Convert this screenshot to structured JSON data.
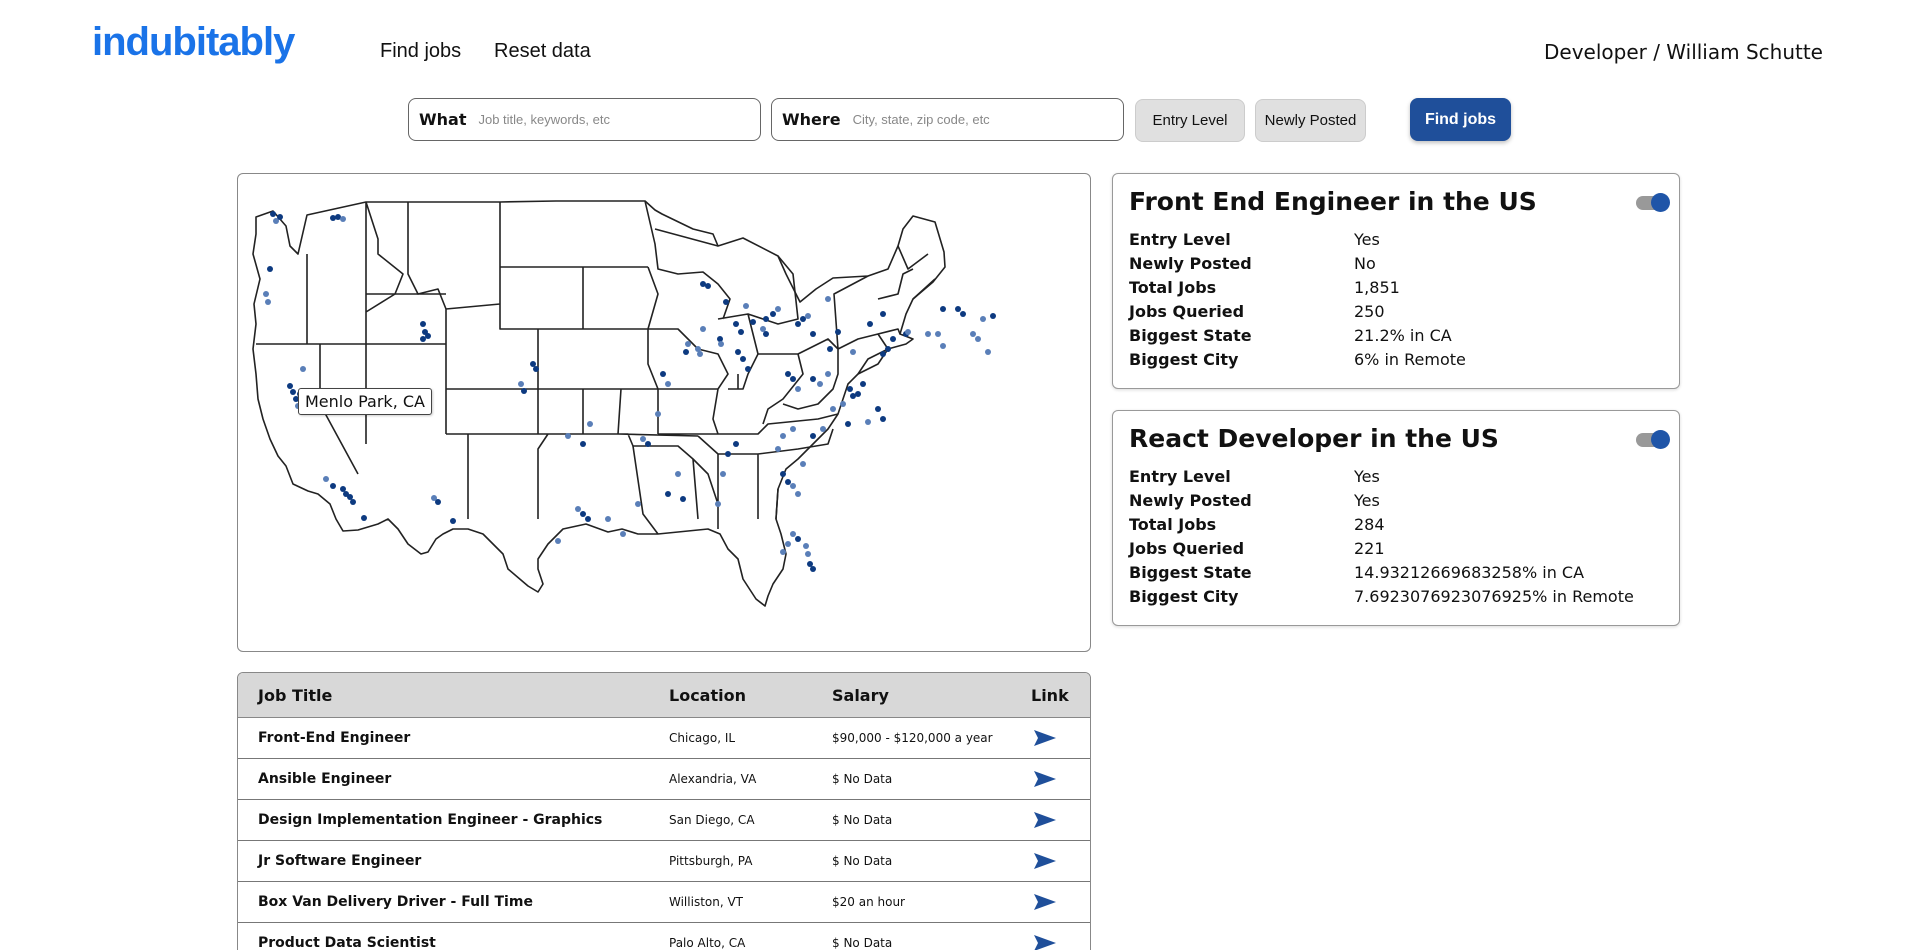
{
  "header": {
    "logo": "indubitably",
    "nav": [
      "Find jobs",
      "Reset data"
    ],
    "user": "Developer / William Schutte"
  },
  "search": {
    "what_label": "What",
    "what_placeholder": "Job title, keywords, etc",
    "where_label": "Where",
    "where_placeholder": "City, state, zip code, etc",
    "filters": [
      "Entry Level",
      "Newly Posted"
    ],
    "find_button": "Find jobs"
  },
  "map": {
    "tooltip": "Menlo Park, CA",
    "dot_colors": [
      "#0d3a80",
      "#5a7fb8"
    ]
  },
  "cards": [
    {
      "title": "Front End Engineer in the US",
      "toggle_on": true,
      "stats": [
        {
          "label": "Entry Level",
          "value": "Yes"
        },
        {
          "label": "Newly Posted",
          "value": "No"
        },
        {
          "label": "Total Jobs",
          "value": "1,851"
        },
        {
          "label": "Jobs Queried",
          "value": "250"
        },
        {
          "label": "Biggest State",
          "value": "21.2% in CA"
        },
        {
          "label": "Biggest City",
          "value": "6% in Remote"
        }
      ]
    },
    {
      "title": "React Developer in the US",
      "toggle_on": true,
      "stats": [
        {
          "label": "Entry Level",
          "value": "Yes"
        },
        {
          "label": "Newly Posted",
          "value": "Yes"
        },
        {
          "label": "Total Jobs",
          "value": "284"
        },
        {
          "label": "Jobs Queried",
          "value": "221"
        },
        {
          "label": "Biggest State",
          "value": "14.93212669683258% in CA"
        },
        {
          "label": "Biggest City",
          "value": "7.6923076923076925% in Remote"
        }
      ]
    }
  ],
  "table": {
    "headers": [
      "Job Title",
      "Location",
      "Salary",
      "Link"
    ],
    "rows": [
      {
        "title": "Front-End Engineer",
        "location": "Chicago, IL",
        "salary": "$90,000 - $120,000 a year"
      },
      {
        "title": "Ansible Engineer",
        "location": "Alexandria, VA",
        "salary": "$ No Data"
      },
      {
        "title": "Design Implementation Engineer - Graphics",
        "location": "San Diego, CA",
        "salary": "$ No Data"
      },
      {
        "title": "Jr Software Engineer",
        "location": "Pittsburgh, PA",
        "salary": "$ No Data"
      },
      {
        "title": "Box Van Delivery Driver - Full Time",
        "location": "Williston, VT",
        "salary": "$20 an hour"
      },
      {
        "title": "Product Data Scientist",
        "location": "Palo Alto, CA",
        "salary": "$ No Data"
      }
    ],
    "link_icon": "send-arrow-icon",
    "accent": "#1f4f9a"
  }
}
